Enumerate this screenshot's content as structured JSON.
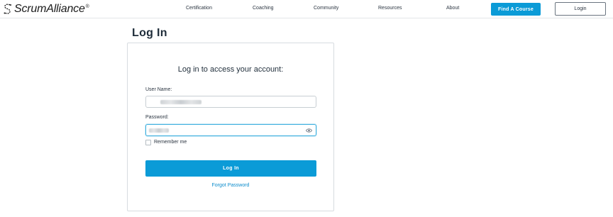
{
  "header": {
    "logo_text": "ScrumAlliance",
    "logo_reg": "®",
    "nav": [
      {
        "label": "Certification"
      },
      {
        "label": "Coaching"
      },
      {
        "label": "Community"
      },
      {
        "label": "Resources"
      },
      {
        "label": "About"
      }
    ],
    "find_course_label": "Find A Course",
    "login_label": "Login"
  },
  "page": {
    "title": "Log In"
  },
  "form": {
    "heading": "Log in to access your account:",
    "username_label": "User Name:",
    "password_label": "Password:",
    "show_password_icon": "eye-icon",
    "remember_label": "Remember me",
    "remember_checked": false,
    "submit_label": "Log In",
    "forgot_label": "Forgot Password"
  },
  "colors": {
    "accent": "#0b9bd7",
    "link": "#0b8ccc",
    "focus_border": "#3fb0de"
  }
}
